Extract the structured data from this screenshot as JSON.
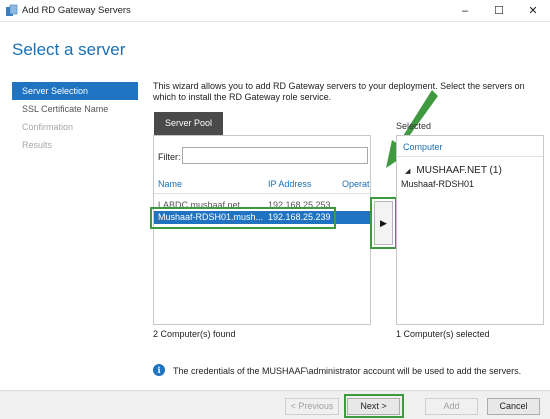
{
  "window": {
    "title": "Add RD Gateway Servers",
    "controls": {
      "minimize": "–",
      "maximize": "☐",
      "close": "✕"
    }
  },
  "header": {
    "page_title": "Select a server"
  },
  "sidebar": {
    "items": [
      {
        "label": "Server Selection",
        "state": "active"
      },
      {
        "label": "SSL Certificate Name",
        "state": "normal"
      },
      {
        "label": "Confirmation",
        "state": "disabled"
      },
      {
        "label": "Results",
        "state": "disabled"
      }
    ]
  },
  "main": {
    "description": "This wizard allows you to add RD Gateway servers to your deployment. Select the servers on which to install the RD Gateway role service.",
    "pool_tab_label": "Server Pool",
    "filter_label": "Filter:",
    "filter_value": "",
    "columns": [
      "Name",
      "IP Address",
      "Operat"
    ],
    "rows": [
      {
        "name": "LABDC.mushaaf.net",
        "ip": "192.168.25.253",
        "selected": false
      },
      {
        "name": "Mushaaf-RDSH01.mush...",
        "ip": "192.168.25.239",
        "selected": true
      }
    ],
    "add_arrow_glyph": "▶",
    "selected_label": "Selected",
    "selected_column": "Computer",
    "selected_group": "MUSHAAF.NET (1)",
    "selected_group_glyph": "◢",
    "selected_items": [
      "Mushaaf-RDSH01"
    ],
    "pool_count": "2 Computer(s) found",
    "selected_count": "1 Computer(s) selected",
    "info_text": "The credentials of the MUSHAAF\\administrator account will be used to add the servers.",
    "info_glyph": "i"
  },
  "footer": {
    "previous": "< Previous",
    "next": "Next >",
    "add": "Add",
    "cancel": "Cancel"
  },
  "colors": {
    "accent": "#1f73c1",
    "title_blue": "#1a6fb3",
    "highlight_green": "#3f9a3f"
  }
}
